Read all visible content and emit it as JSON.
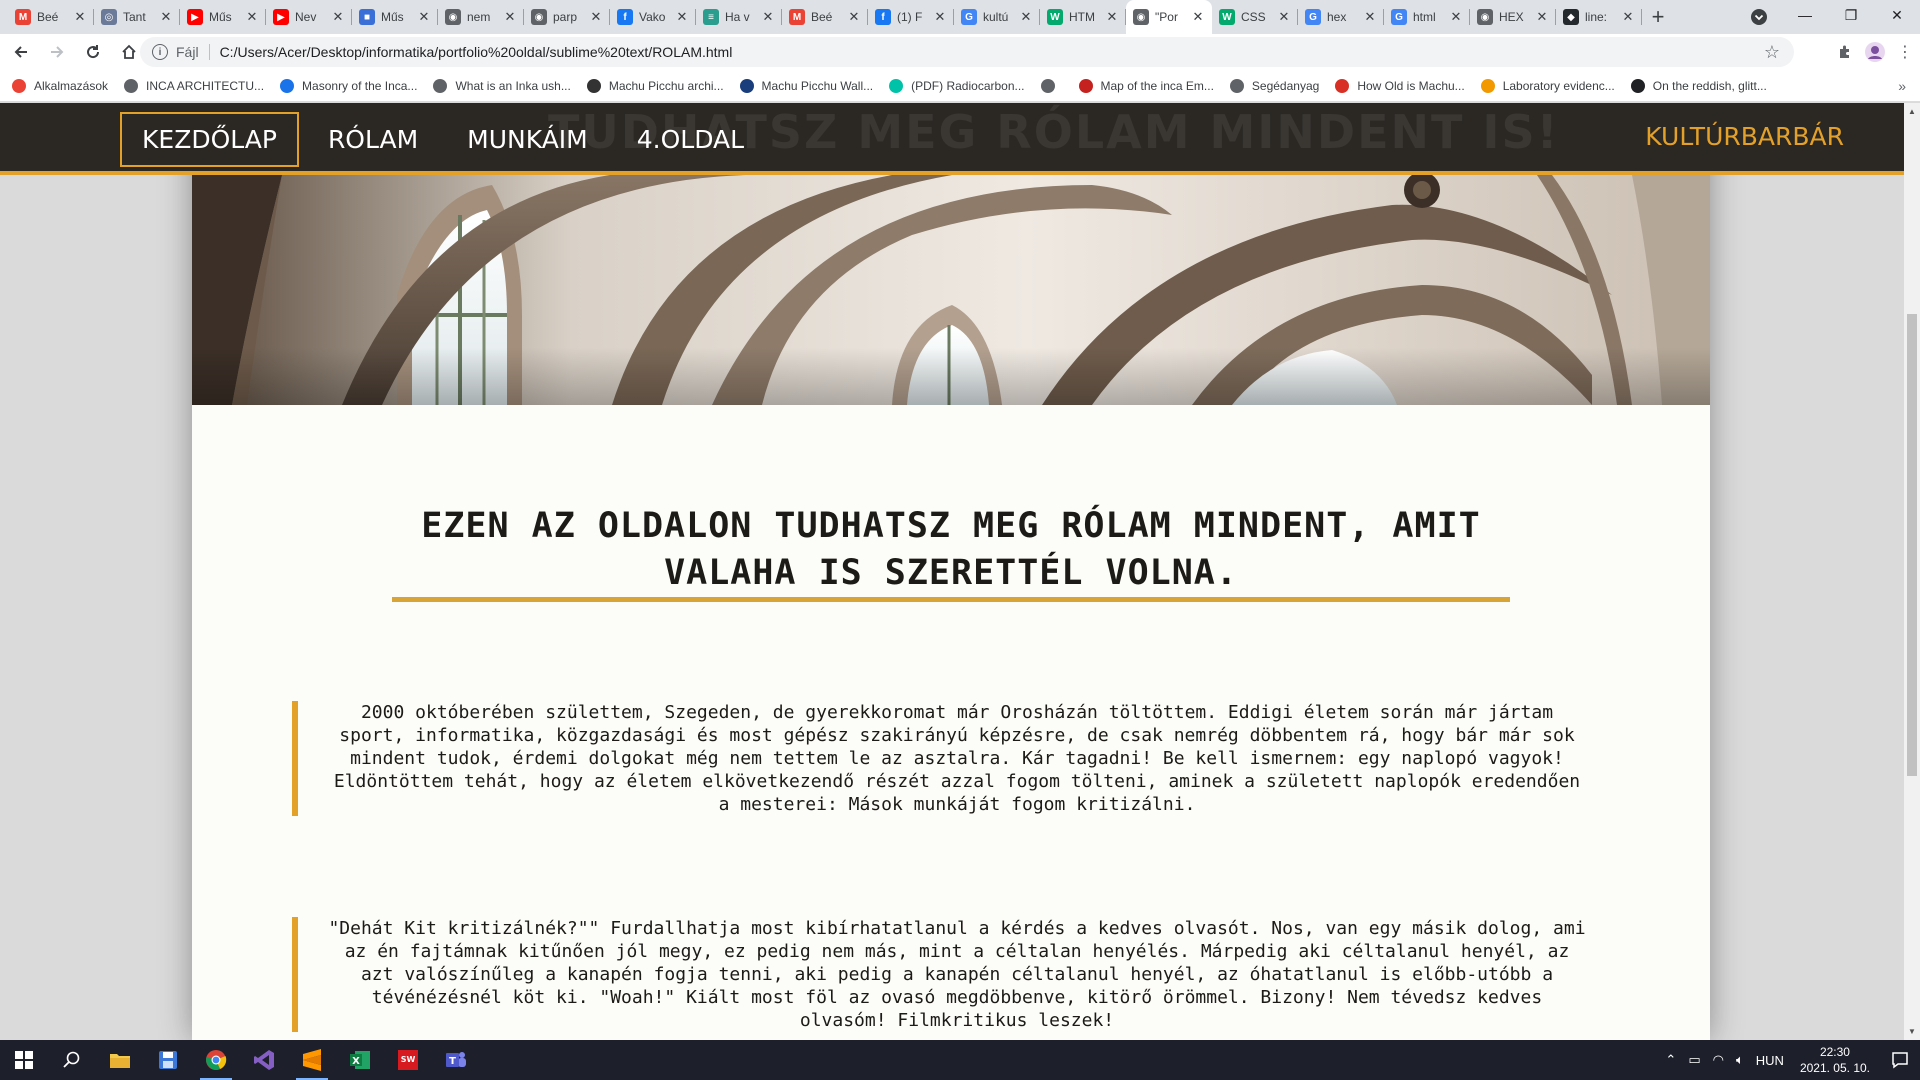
{
  "browser": {
    "tabs": [
      {
        "title": "Beé",
        "icon": "gmail-icon",
        "color": "#ea4335",
        "glyph": "M"
      },
      {
        "title": "Tant",
        "icon": "globe-icon",
        "color": "#6b7a99",
        "glyph": "◎"
      },
      {
        "title": "Műs",
        "icon": "youtube-icon",
        "color": "#ff0000",
        "glyph": "▶"
      },
      {
        "title": "Nev",
        "icon": "youtube-icon",
        "color": "#ff0000",
        "glyph": "▶"
      },
      {
        "title": "Műs",
        "icon": "cube-icon",
        "color": "#3b6fd8",
        "glyph": "■"
      },
      {
        "title": "nem",
        "icon": "globe-icon",
        "color": "#5f6368",
        "glyph": "◉"
      },
      {
        "title": "parp",
        "icon": "globe-icon",
        "color": "#5f6368",
        "glyph": "◉"
      },
      {
        "title": "Vako",
        "icon": "facebook-icon",
        "color": "#1877f2",
        "glyph": "f"
      },
      {
        "title": "Ha v",
        "icon": "site-icon",
        "color": "#2a9d8f",
        "glyph": "≡"
      },
      {
        "title": "Beé",
        "icon": "gmail-icon",
        "color": "#ea4335",
        "glyph": "M"
      },
      {
        "title": "(1) F",
        "icon": "facebook-icon",
        "color": "#1877f2",
        "glyph": "f"
      },
      {
        "title": "kultú",
        "icon": "google-icon",
        "color": "#4285f4",
        "glyph": "G"
      },
      {
        "title": "HTM",
        "icon": "w3schools-icon",
        "color": "#04aa6d",
        "glyph": "W"
      },
      {
        "title": "\"Por",
        "icon": "globe-icon",
        "color": "#5f6368",
        "glyph": "◉",
        "active": true
      },
      {
        "title": "CSS",
        "icon": "w3schools-icon",
        "color": "#04aa6d",
        "glyph": "W"
      },
      {
        "title": "hex",
        "icon": "google-icon",
        "color": "#4285f4",
        "glyph": "G"
      },
      {
        "title": "html",
        "icon": "google-icon",
        "color": "#4285f4",
        "glyph": "G"
      },
      {
        "title": "HEX",
        "icon": "globe-icon",
        "color": "#5f6368",
        "glyph": "◉"
      },
      {
        "title": "line:",
        "icon": "github-icon",
        "color": "#24292e",
        "glyph": "◆"
      }
    ],
    "address": {
      "scheme_label": "Fájl",
      "url": "C:/Users/Acer/Desktop/informatika/portfolio%20oldal/sublime%20text/ROLAM.html"
    },
    "bookmarks": [
      {
        "label": "Alkalmazások",
        "color": "#ea4335"
      },
      {
        "label": "INCA ARCHITECTU...",
        "color": "#5f6368"
      },
      {
        "label": "Masonry of the Inca...",
        "color": "#1a73e8"
      },
      {
        "label": "What is an Inka ush...",
        "color": "#5f6368"
      },
      {
        "label": "Machu Picchu archi...",
        "color": "#333333"
      },
      {
        "label": "Machu Picchu Wall...",
        "color": "#1a3d7c"
      },
      {
        "label": "(PDF) Radiocarbon...",
        "color": "#00c2a8"
      },
      {
        "label": "",
        "color": "#5f6368"
      },
      {
        "label": "Map of the inca Em...",
        "color": "#c5221f"
      },
      {
        "label": "Segédanyag",
        "color": "#5f6368"
      },
      {
        "label": "How Old is Machu...",
        "color": "#d93025"
      },
      {
        "label": "Laboratory evidenc...",
        "color": "#f29900"
      },
      {
        "label": "On the reddish, glitt...",
        "color": "#202124"
      }
    ]
  },
  "site": {
    "nav": [
      {
        "label": "KEZDŐLAP",
        "active": true
      },
      {
        "label": "RÓLAM"
      },
      {
        "label": "MUNKÁIM"
      },
      {
        "label": "4.OLDAL"
      }
    ],
    "ghost_text": "TUDHATSZ MEG RÓLAM MINDENT IS!",
    "brand": "KULTÚRBARBÁR",
    "heading": "EZEN AZ OLDALON TUDHATSZ MEG RÓLAM MINDENT, AMIT VALAHA IS SZERETTÉL VOLNA.",
    "paragraphs": [
      "2000 októberében születtem, Szegeden, de gyerekkoromat már Orosházán töltöttem. Eddigi életem során már jártam sport, informatika, közgazdasági és most gépész szakirányú képzésre, de csak nemrég döbbentem rá, hogy bár már sok mindent tudok, érdemi dolgokat még nem tettem le az asztalra. Kár tagadni! Be kell ismernem: egy naplopó vagyok! Eldöntöttem tehát, hogy az életem elkövetkezendő részét azzal fogom tölteni, aminek a született naplopók eredendően a mesterei: Mások munkáját fogom kritizálni.",
      "\"Dehát Kit kritizálnék?\"\" Furdallhatja most kibírhatatlanul a kérdés a kedves olvasót. Nos, van egy másik dolog, ami az én fajtámnak kitűnően jól megy, ez pedig nem más, mint a céltalan henyélés. Márpedig aki céltalanul henyél, az azt valószínűleg a kanapén fogja tenni, aki pedig a kanapén céltalanul henyél, az óhatatlanul is előbb-utóbb a tévénézésnél köt ki. \"Woah!\" Kiált most föl az ovasó megdöbbenve, kitörő örömmel. Bizony! Nem tévedsz kedves olvasóm! Filmkritikus leszek!"
    ],
    "colors": {
      "accent": "#e3a12a",
      "nav_bg": "#2b2824",
      "page_bg": "#fcfcf9"
    }
  },
  "taskbar": {
    "apps": [
      {
        "name": "start-icon"
      },
      {
        "name": "search-icon"
      },
      {
        "name": "file-explorer-icon"
      },
      {
        "name": "save-disk-icon"
      },
      {
        "name": "chrome-icon",
        "open": true
      },
      {
        "name": "visual-studio-icon"
      },
      {
        "name": "sublime-text-icon",
        "open": true
      },
      {
        "name": "excel-icon"
      },
      {
        "name": "solidworks-icon"
      },
      {
        "name": "teams-icon"
      }
    ],
    "lang": "HUN",
    "time": "22:30",
    "date": "2021. 05. 10."
  }
}
